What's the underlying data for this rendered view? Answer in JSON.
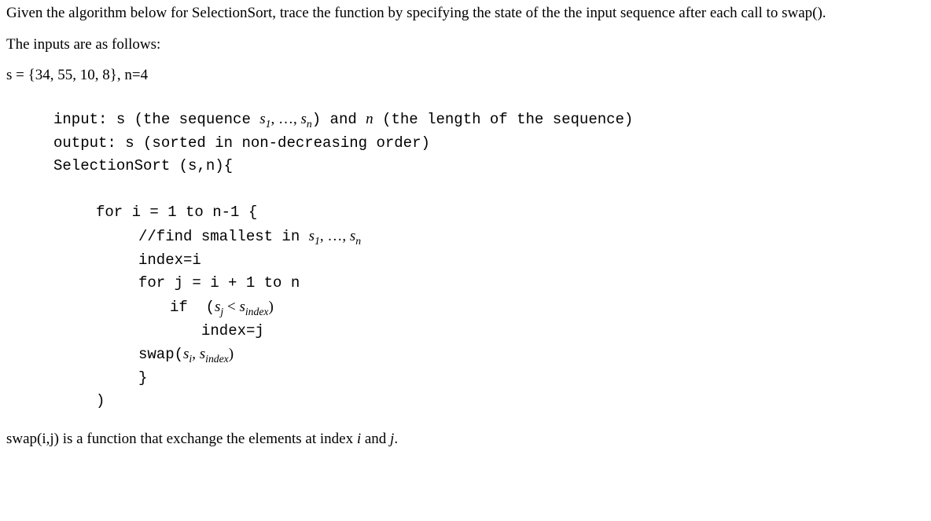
{
  "question": {
    "line1": "Given the algorithm below for SelectionSort, trace the function by specifying the state of the the input sequence after each call to swap().",
    "line2": "The inputs are as follows:",
    "line3_prefix": "s = {34, 55, 10, 8}, n=4"
  },
  "algo": {
    "input_label": "input: s (the sequence ",
    "seq_s1": "s",
    "seq_sub1": "1",
    "seq_mid": ", …, ",
    "seq_sn": "s",
    "seq_subn": "n",
    "input_tail": ") and ",
    "n_var": "n",
    "input_tail2": " (the length of the sequence)",
    "output": "output: s (sorted in non-decreasing order)",
    "fn_sig": "SelectionSort (s,n){",
    "for_i": "for i = 1 to n-1 {",
    "comment_pre": "//find smallest in ",
    "index_i": "index=i",
    "for_j": "for j = i + 1 to n",
    "if_pre": "if  (",
    "sj_s": "s",
    "sj_sub": "j",
    "lt": " < ",
    "sindex_s": "s",
    "sindex_sub": "index",
    "if_close": ")",
    "index_j": "index=j",
    "swap_pre": "swap(",
    "si_s": "s",
    "si_sub": "i",
    "comma_sp": ", ",
    "swap_close": ")",
    "brace_close": "}",
    "paren_close": ")"
  },
  "footer": {
    "text_pre": "swap(i,j) is a function that exchange the elements at index ",
    "i": "i",
    "and": " and ",
    "j": "j",
    "period": "."
  }
}
